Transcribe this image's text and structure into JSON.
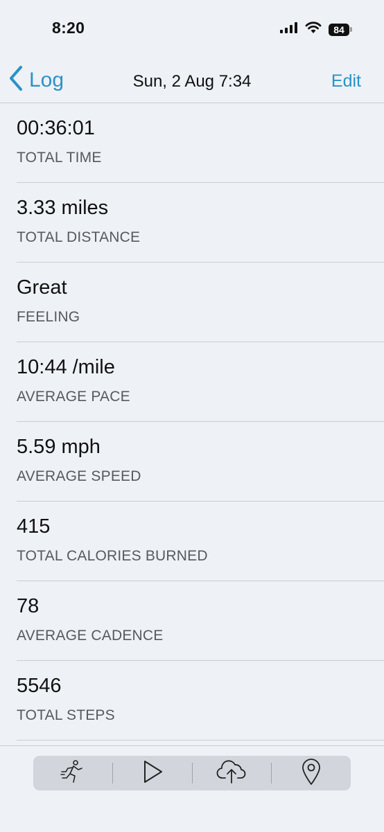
{
  "status_bar": {
    "time": "8:20",
    "battery": "84"
  },
  "nav": {
    "back_label": "Log",
    "title": "Sun, 2 Aug 7:34",
    "edit_label": "Edit"
  },
  "stats": [
    {
      "value": "00:36:01",
      "label": "TOTAL TIME"
    },
    {
      "value": "3.33 miles",
      "label": "TOTAL DISTANCE"
    },
    {
      "value": "Great",
      "label": "FEELING"
    },
    {
      "value": "10:44 /mile",
      "label": "AVERAGE PACE"
    },
    {
      "value": "5.59 mph",
      "label": "AVERAGE SPEED"
    },
    {
      "value": "415",
      "label": "TOTAL CALORIES BURNED"
    },
    {
      "value": "78",
      "label": "AVERAGE CADENCE"
    },
    {
      "value": "5546",
      "label": "TOTAL STEPS"
    }
  ],
  "toolbar": {
    "icons": [
      "runner-icon",
      "play-icon",
      "cloud-upload-icon",
      "map-pin-icon"
    ]
  },
  "colors": {
    "accent": "#2a92c7",
    "background": "#eef1f5",
    "toolbar": "#d2d6dc"
  }
}
